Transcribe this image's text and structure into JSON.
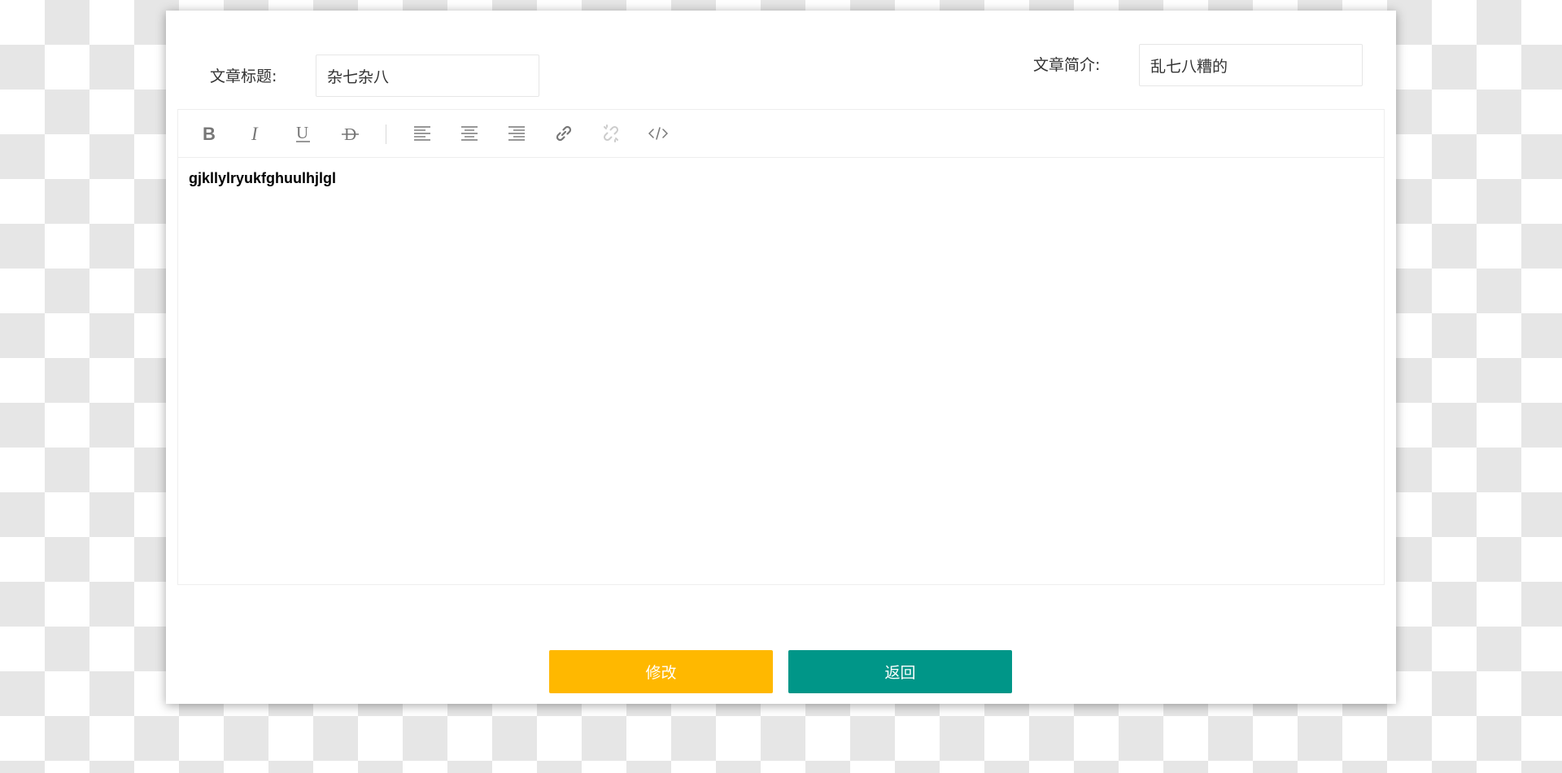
{
  "form": {
    "title_label": "文章标题:",
    "title_value": "杂七杂八",
    "summary_label": "文章简介:",
    "summary_value": "乱七八糟的"
  },
  "editor": {
    "toolbar": [
      {
        "name": "bold-icon",
        "tooltip": "bold"
      },
      {
        "name": "italic-icon",
        "tooltip": "italic"
      },
      {
        "name": "underline-icon",
        "tooltip": "underline"
      },
      {
        "name": "strikethrough-icon",
        "tooltip": "strikethrough"
      },
      {
        "name": "align-left-icon",
        "tooltip": "align left"
      },
      {
        "name": "align-center-icon",
        "tooltip": "align center"
      },
      {
        "name": "align-right-icon",
        "tooltip": "align right"
      },
      {
        "name": "link-icon",
        "tooltip": "link"
      },
      {
        "name": "unlink-icon",
        "tooltip": "unlink",
        "disabled": true
      },
      {
        "name": "code-icon",
        "tooltip": "code"
      }
    ],
    "content": "gjkllylryukfghuulhjlgl"
  },
  "buttons": {
    "modify_label": "修改",
    "back_label": "返回"
  },
  "colors": {
    "modify": "#FFB800",
    "back": "#009688",
    "checker": "#e6e6e6"
  }
}
